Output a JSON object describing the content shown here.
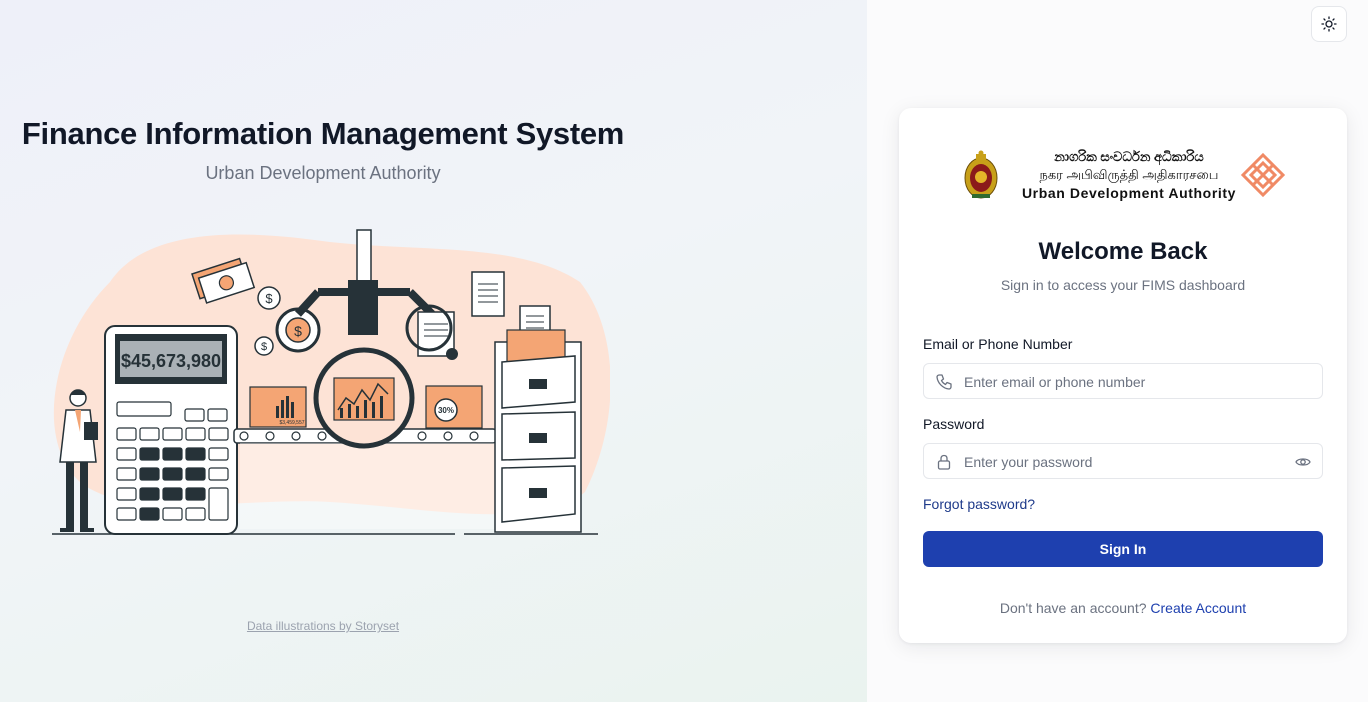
{
  "hero": {
    "title": "Finance Information Management System",
    "subtitle": "Urban Development Authority",
    "calculator_display": "$45,673,980",
    "folder_small_label": "$3,459,557",
    "folder_percent_label": "30%",
    "credit": "Data illustrations by Storyset"
  },
  "header": {
    "theme_toggle_icon": "sun-icon"
  },
  "logo": {
    "line_sinhala": "නාගරික සංවර්ධන අධිකාරිය",
    "line_tamil": "நகர அபிவிருத்தி அதிகாரசபை",
    "line_english": "Urban  Development  Authority"
  },
  "login": {
    "title": "Welcome Back",
    "subtitle": "Sign in to access your FIMS dashboard",
    "email_label": "Email or Phone Number",
    "email_placeholder": "Enter email or phone number",
    "password_label": "Password",
    "password_placeholder": "Enter your password",
    "forgot": "Forgot password?",
    "submit": "Sign In",
    "no_account": "Don't have an account?",
    "create_account": "Create Account"
  },
  "colors": {
    "primary": "#1e40af",
    "illustration_accent": "#f4a574",
    "illustration_blob": "#fde3d6",
    "dark": "#263238"
  }
}
